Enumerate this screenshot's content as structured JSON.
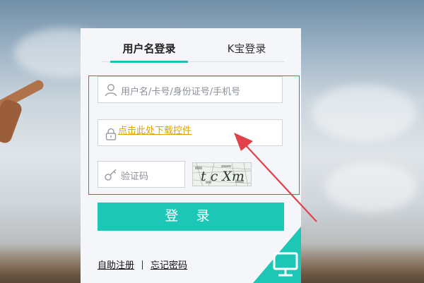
{
  "tabs": {
    "username_login": "用户名登录",
    "kbao_login": "K宝登录"
  },
  "form": {
    "username_placeholder": "用户名/卡号/身份证号/手机号",
    "download_control_link": "点击此处下载控件",
    "captcha_placeholder": "验证码",
    "captcha_image_text": "t c Xm"
  },
  "buttons": {
    "login_label": "登 录"
  },
  "links": {
    "register": "自助注册",
    "forgot_password": "忘记密码"
  },
  "colors": {
    "accent": "#1dc7b6",
    "link_warning": "#e0a200",
    "annotation_red": "#e0414a"
  },
  "icons": {
    "username": "user-icon",
    "password": "lock-icon",
    "captcha": "key-icon",
    "corner": "monitor-icon"
  }
}
